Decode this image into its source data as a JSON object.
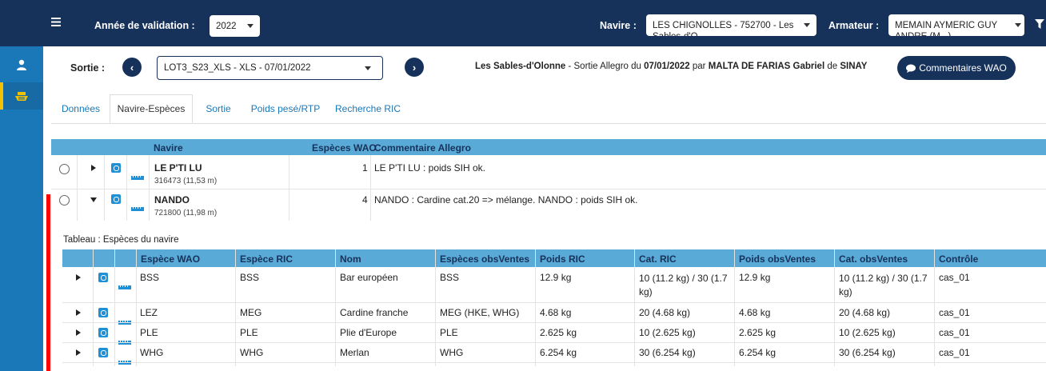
{
  "topbar": {
    "menu_icon": "hamburger-icon",
    "year_label": "Année de validation :",
    "year_value": "2022",
    "navire_label": "Navire :",
    "navire_value": "LES CHIGNOLLES - 752700 - Les Sables-d'O...",
    "armateur_label": "Armateur :",
    "armateur_value": "MEMAIN AYMERIC GUY ANDRE (M...)",
    "filter_icon": "filter-icon"
  },
  "rail": {
    "items": [
      {
        "icon": "user-icon"
      },
      {
        "icon": "boat-icon"
      }
    ],
    "accent": "#f2c200"
  },
  "sortie": {
    "label": "Sortie :",
    "value": "LOT3_S23_XLS - XLS - 07/01/2022",
    "info_port": "Les Sables-d'Olonne",
    "info_mid": " - Sortie Allegro du ",
    "info_date": "07/01/2022",
    "info_par": " par ",
    "info_person": "MALTA DE FARIAS Gabriel",
    "info_de": " de ",
    "info_org": "SINAY",
    "comment_button": "Commentaires WAO"
  },
  "tabs": [
    {
      "label": "Données"
    },
    {
      "label": "Navire-Espèces"
    },
    {
      "label": "Sortie"
    },
    {
      "label": "Poids pesé/RTP"
    },
    {
      "label": "Recherche RIC"
    }
  ],
  "vessels_table": {
    "headers": {
      "navire": "Navire",
      "especes": "Espèces WAO",
      "commentaire": "Commentaire Allegro"
    },
    "rows": [
      {
        "name": "LE P'TI LU",
        "sub": "316473 (11,53 m)",
        "especes": "1",
        "commentaire": "LE P'TI LU : poids SIH ok."
      },
      {
        "name": "NANDO",
        "sub": "721800 (11,98 m)",
        "especes": "4",
        "commentaire": "NANDO : Cardine cat.20 => mélange. NANDO : poids SIH ok."
      }
    ]
  },
  "species_table": {
    "caption": "Tableau : Espèces du navire",
    "headers": [
      "Espèce WAO",
      "Espèce RIC",
      "Nom",
      "Espèces obsVentes",
      "Poids RIC",
      "Cat. RIC",
      "Poids obsVentes",
      "Cat. obsVentes",
      "Contrôle"
    ],
    "rows": [
      [
        "BSS",
        "BSS",
        "Bar européen",
        "BSS",
        "12.9 kg",
        "10 (11.2 kg) / 30 (1.7 kg)",
        "12.9 kg",
        "10 (11.2 kg) / 30 (1.7 kg)",
        "cas_01"
      ],
      [
        "LEZ",
        "MEG",
        "Cardine franche",
        "MEG (HKE, WHG)",
        "4.68 kg",
        "20 (4.68 kg)",
        "4.68 kg",
        "20 (4.68 kg)",
        "cas_01"
      ],
      [
        "PLE",
        "PLE",
        "Plie d'Europe",
        "PLE",
        "2.625 kg",
        "10 (2.625 kg)",
        "2.625 kg",
        "10 (2.625 kg)",
        "cas_01"
      ],
      [
        "WHG",
        "WHG",
        "Merlan",
        "WHG",
        "6.254 kg",
        "30 (6.254 kg)",
        "6.254 kg",
        "30 (6.254 kg)",
        "cas_01"
      ]
    ]
  },
  "colors": {
    "header_dark": "#17325a",
    "rail_blue": "#1a78b8",
    "table_head": "#5aaad8",
    "marker_red": "#ff0000"
  }
}
